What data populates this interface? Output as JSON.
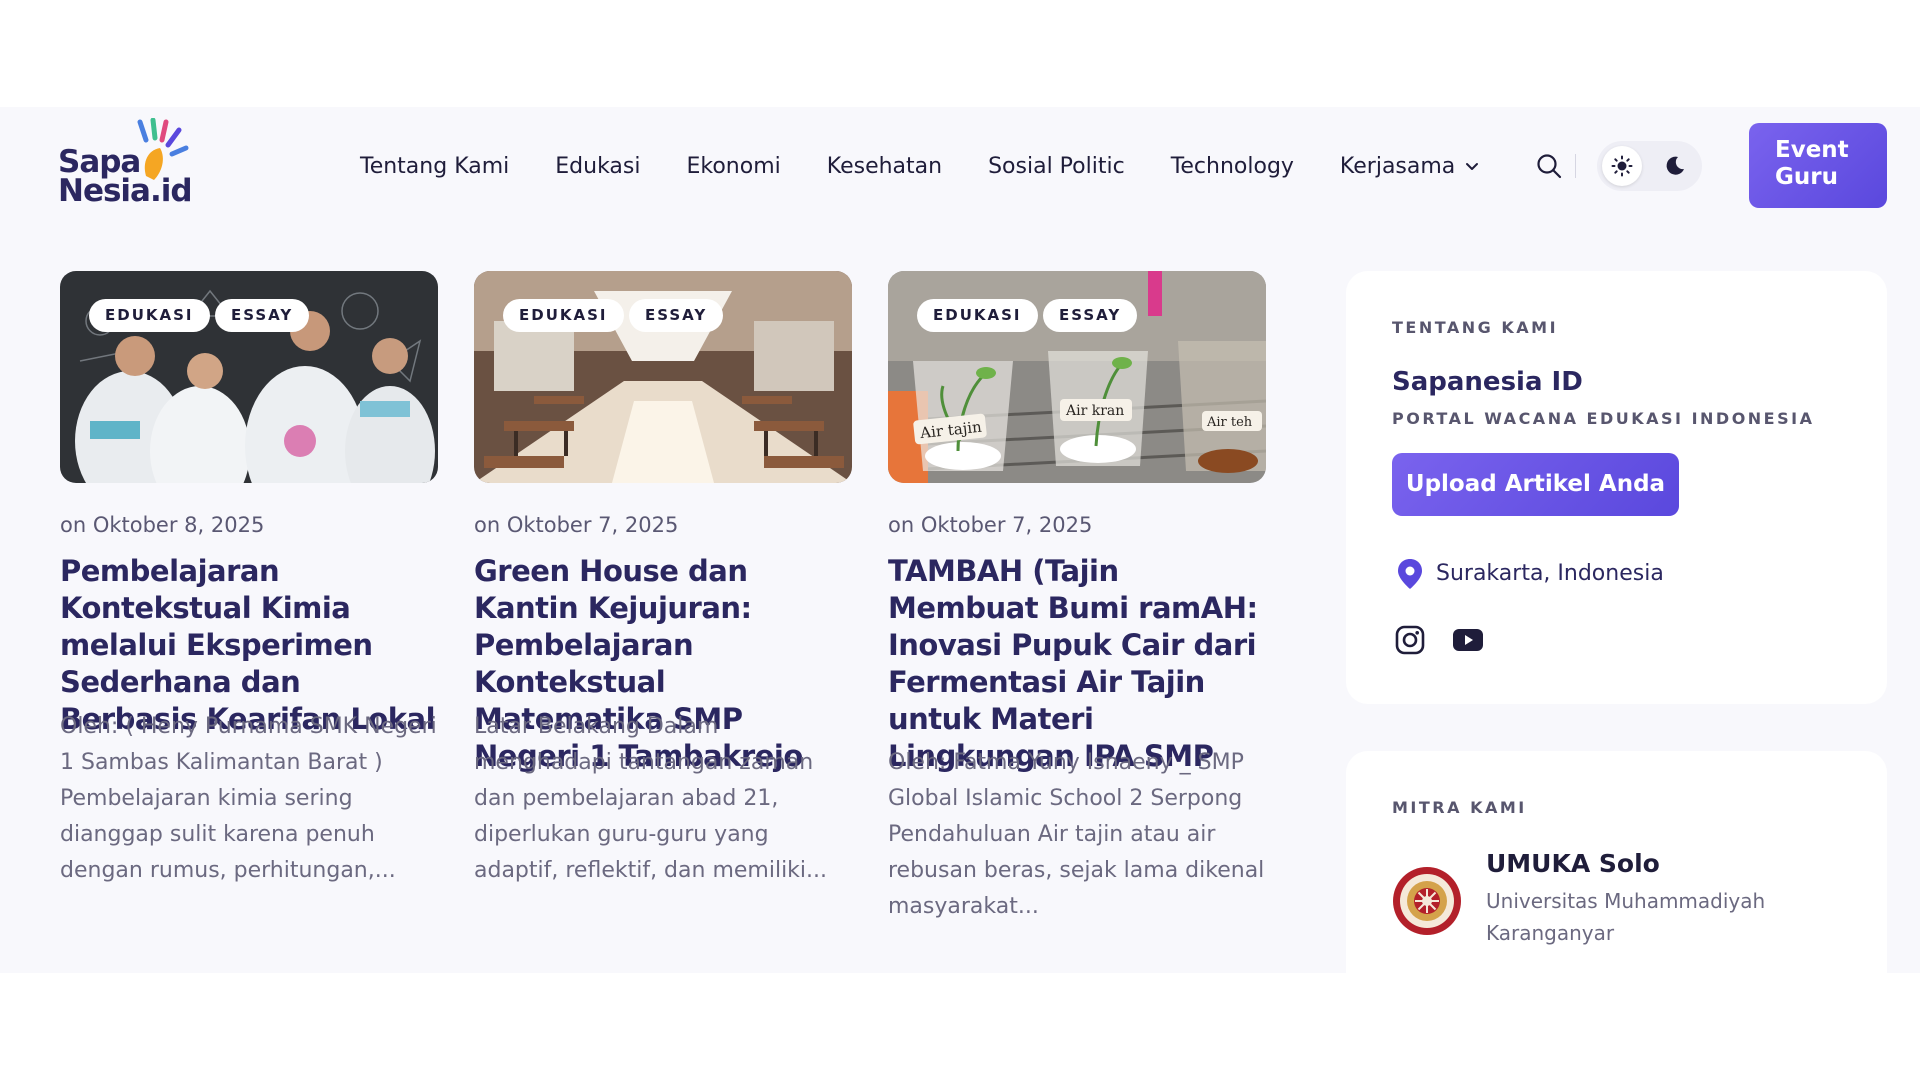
{
  "brand": {
    "logo_line1": "Sapa",
    "logo_line2": "Nesia.id",
    "accent": "#5a48dd",
    "heading_color": "#2b2760"
  },
  "nav": {
    "items": [
      "Tentang Kami",
      "Edukasi",
      "Ekonomi",
      "Kesehatan",
      "Sosial Politic",
      "Technology",
      "Kerjasama"
    ],
    "event_button": "Event Guru"
  },
  "cards": [
    {
      "tags": [
        "EDUKASI",
        "ESSAY"
      ],
      "date": "on Oktober 8, 2025",
      "title": "Pembelajaran Kontekstual Kimia melalui Eksperimen Sederhana dan Berbasis Kearifan Lokal",
      "excerpt": "Oleh: ( Heny Purnama SMK Negeri 1 Sambas Kalimantan Barat ) Pembelajaran kimia sering dianggap sulit karena penuh dengan rumus, perhitungan,..."
    },
    {
      "tags": [
        "EDUKASI",
        "ESSAY"
      ],
      "date": "on Oktober 7, 2025",
      "title": "Green House dan Kantin Kejujuran: Pembelajaran Kontekstual Matematika SMP Negeri 1 Tambakrejo",
      "excerpt": "Latar Belakang  Dalam menghadapi tantangan zaman dan pembelajaran abad 21, diperlukan guru-guru yang adaptif, reflektif, dan memiliki..."
    },
    {
      "tags": [
        "EDUKASI",
        "ESSAY"
      ],
      "date": "on Oktober 7, 2025",
      "title": "TAMBAH (Tajin Membuat Bumi ramAH: Inovasi Pupuk Cair dari Fermentasi Air Tajin untuk Materi Lingkungan IPA SMP",
      "excerpt": "Oleh: Fatma Yuny Isnaeny _ SMP Global Islamic School 2 Serpong Pendahuluan Air tajin atau air rebusan beras, sejak lama dikenal masyarakat...",
      "image_labels": [
        "Air tajin",
        "Air kran",
        "Air teh"
      ]
    }
  ],
  "about": {
    "label": "TENTANG KAMI",
    "name": "Sapanesia ID",
    "tagline": "PORTAL WACANA EDUKASI INDONESIA",
    "upload_button": "Upload Artikel Anda",
    "location": "Surakarta, Indonesia"
  },
  "partners": {
    "label": "MITRA KAMI",
    "items": [
      {
        "name": "UMUKA Solo",
        "desc": "Universitas Muhammadiyah Karanganyar"
      }
    ]
  }
}
